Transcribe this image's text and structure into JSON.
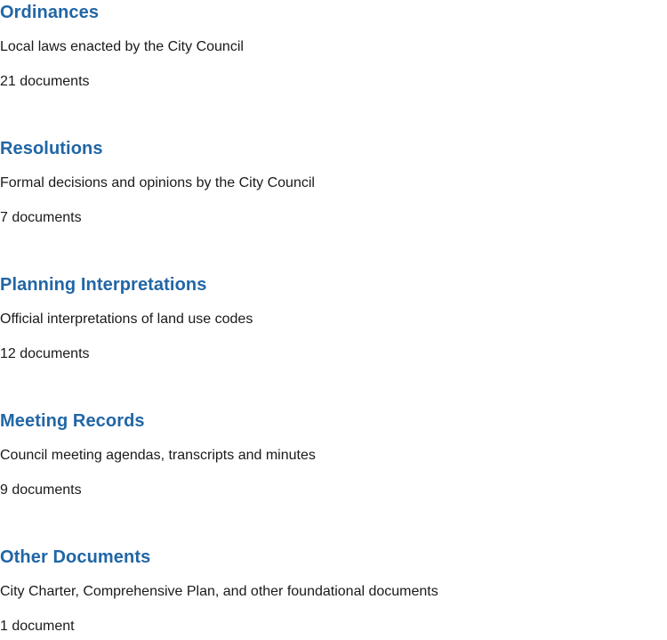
{
  "categories": [
    {
      "title": "Ordinances",
      "description": "Local laws enacted by the City Council",
      "count": "21 documents"
    },
    {
      "title": "Resolutions",
      "description": "Formal decisions and opinions by the City Council",
      "count": "7 documents"
    },
    {
      "title": "Planning Interpretations",
      "description": "Official interpretations of land use codes",
      "count": "12 documents"
    },
    {
      "title": "Meeting Records",
      "description": "Council meeting agendas, transcripts and minutes",
      "count": "9 documents"
    },
    {
      "title": "Other Documents",
      "description": "City Charter, Comprehensive Plan, and other foundational documents",
      "count": "1 document"
    }
  ],
  "colors": {
    "title": "#2166a6",
    "text": "#1a1a1a"
  }
}
